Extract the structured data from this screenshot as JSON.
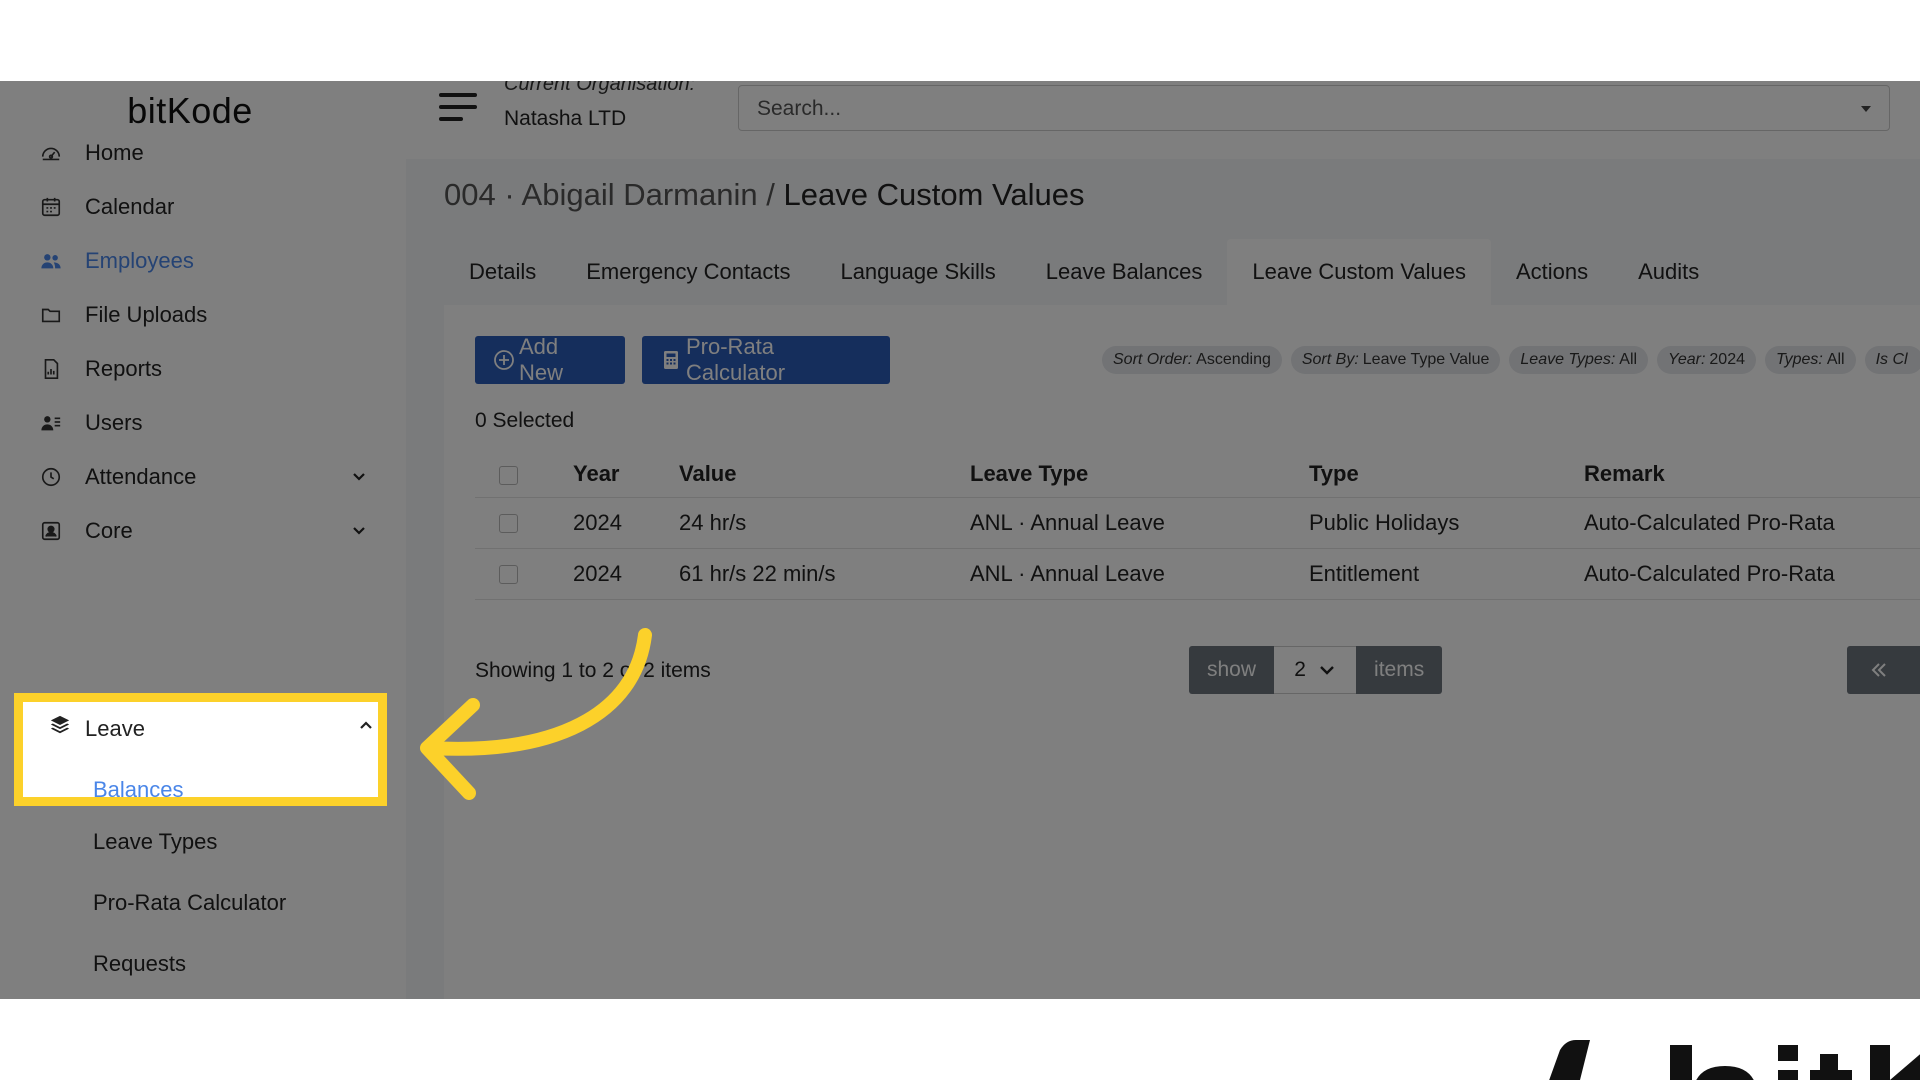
{
  "brand": {
    "logo_text": "bitKode"
  },
  "topbar": {
    "org_caption": "Current Organisation:",
    "org_name": "Natasha LTD",
    "search_placeholder": "Search..."
  },
  "sidebar": {
    "items": [
      {
        "label": "Home",
        "icon": "dashboard-icon"
      },
      {
        "label": "Calendar",
        "icon": "calendar-icon"
      },
      {
        "label": "Employees",
        "icon": "people-icon",
        "active": true
      },
      {
        "label": "File Uploads",
        "icon": "folder-icon"
      },
      {
        "label": "Reports",
        "icon": "report-icon"
      },
      {
        "label": "Users",
        "icon": "user-list-icon"
      },
      {
        "label": "Attendance",
        "icon": "clock-icon",
        "expandable": true
      },
      {
        "label": "Core",
        "icon": "id-card-icon",
        "expandable": true
      },
      {
        "label": "Leave",
        "icon": "layers-icon",
        "expanded": true
      }
    ],
    "leave_subitems": [
      {
        "label": "Balances",
        "active": true
      },
      {
        "label": "Leave Types"
      },
      {
        "label": "Pro-Rata Calculator"
      },
      {
        "label": "Requests"
      }
    ]
  },
  "page": {
    "crumb": "004 · Abigail Darmanin",
    "separator": "/",
    "title": "Leave Custom Values"
  },
  "tabs": [
    {
      "label": "Details"
    },
    {
      "label": "Emergency Contacts"
    },
    {
      "label": "Language Skills"
    },
    {
      "label": "Leave Balances"
    },
    {
      "label": "Leave Custom Values",
      "active": true
    },
    {
      "label": "Actions"
    },
    {
      "label": "Audits"
    }
  ],
  "toolbar": {
    "add_label": "Add New",
    "prorata_label": "Pro-Rata Calculator"
  },
  "filters": [
    {
      "key": "Sort Order:",
      "value": "Ascending"
    },
    {
      "key": "Sort By:",
      "value": "Leave Type Value"
    },
    {
      "key": "Leave Types:",
      "value": "All"
    },
    {
      "key": "Year:",
      "value": "2024"
    },
    {
      "key": "Types:",
      "value": "All"
    },
    {
      "key": "Is Cl",
      "value": ""
    }
  ],
  "selection": {
    "count_text": "0 Selected"
  },
  "table": {
    "columns": [
      "Year",
      "Value",
      "Leave Type",
      "Type",
      "Remark"
    ],
    "rows": [
      [
        "2024",
        "24 hr/s",
        "ANL · Annual Leave",
        "Public Holidays",
        "Auto-Calculated Pro-Rata"
      ],
      [
        "2024",
        "61 hr/s 22 min/s",
        "ANL · Annual Leave",
        "Entitlement",
        "Auto-Calculated Pro-Rata"
      ]
    ]
  },
  "pagination": {
    "showing_text": "Showing 1 to 2 of 2 items",
    "show_label": "show",
    "page_size": "2",
    "items_label": "items"
  },
  "colors": {
    "highlight": "#fcd12a",
    "primary_button": "#2b5cb8",
    "active_link": "#4a86e8"
  }
}
